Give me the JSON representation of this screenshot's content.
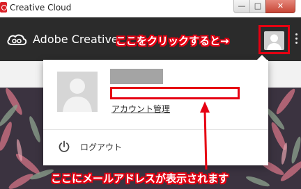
{
  "window": {
    "title": "Creative Cloud",
    "controls": {
      "minimize": "—",
      "maximize": "□",
      "close": "✕"
    }
  },
  "header": {
    "app_name": "Adobe Creative",
    "logo_icon": "creative-cloud-logo-icon",
    "avatar_icon": "user-silhouette-icon",
    "menu_icon": "kebab-menu-icon"
  },
  "popup": {
    "manage_account_label": "アカウント管理",
    "logout_label": "ログアウト",
    "logout_icon": "power-icon",
    "name_redacted": true,
    "email_redacted": true
  },
  "annotations": {
    "click_here": "ここをクリックすると→",
    "email_shown_here": "ここにメールアドレスが表示されます",
    "highlight_color": "#e60012"
  },
  "colors": {
    "header_bg": "#2b2b2b",
    "annotation_red": "#e60012",
    "close_button": "#c74535"
  }
}
